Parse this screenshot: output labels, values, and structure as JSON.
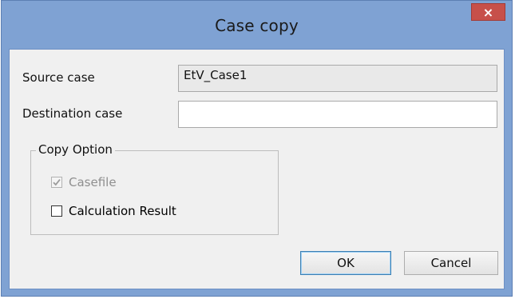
{
  "window": {
    "title": "Case copy",
    "close_glyph": "×"
  },
  "form": {
    "source_label": "Source case",
    "source_value": "EtV_Case1",
    "destination_label": "Destination case",
    "destination_value": ""
  },
  "copy_option": {
    "legend": "Copy Option",
    "casefile_label": "Casefile",
    "casefile_checked": true,
    "casefile_enabled": false,
    "calc_result_label": "Calculation Result",
    "calc_result_checked": false
  },
  "buttons": {
    "ok_label": "OK",
    "cancel_label": "Cancel"
  },
  "colors": {
    "frame": "#7fa2d3",
    "close_button": "#c7504a",
    "client_bg": "#f0f0f0"
  },
  "icons": {
    "close": "close-icon",
    "check": "checkmark-icon"
  }
}
